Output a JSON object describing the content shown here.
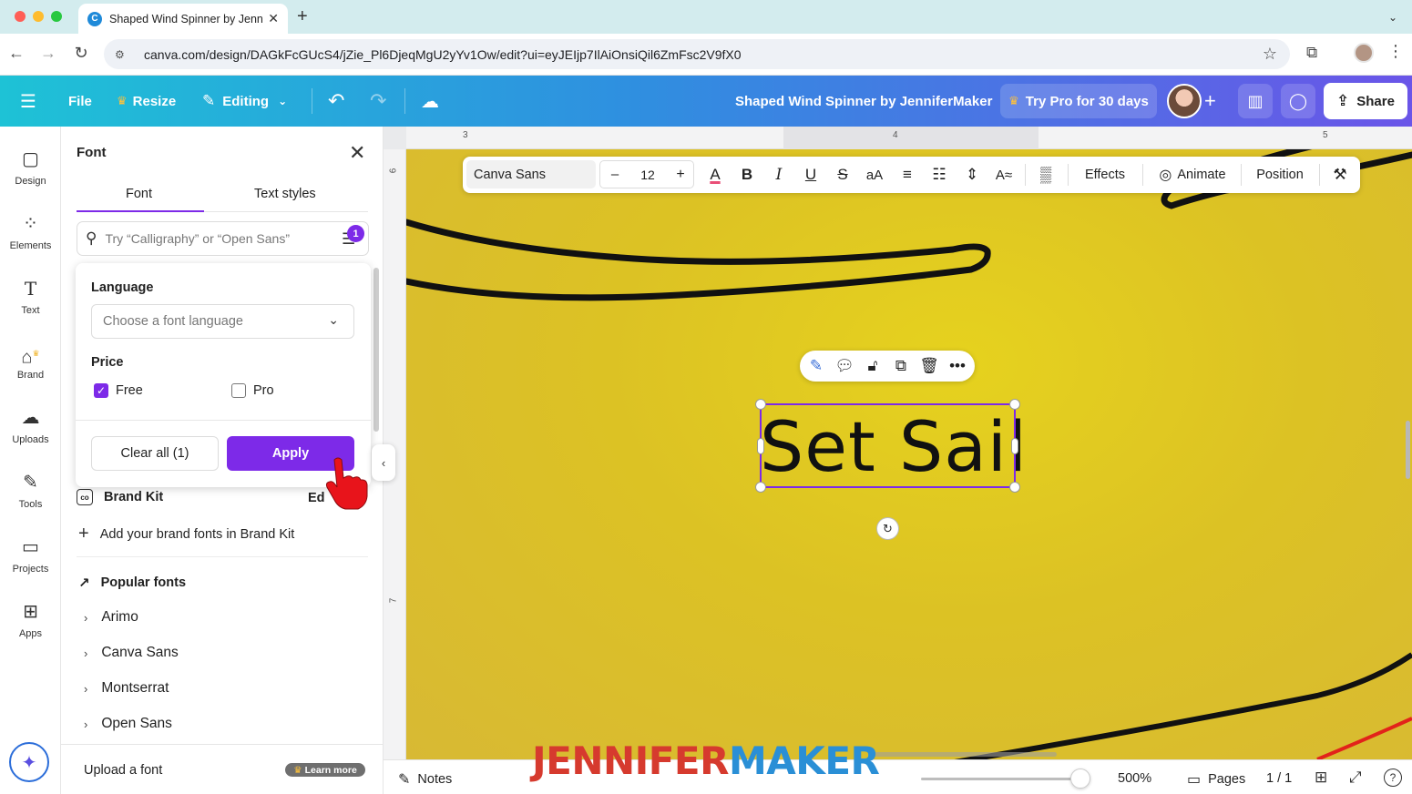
{
  "browser": {
    "tab_title": "Shaped Wind Spinner by Jenni",
    "url": "canva.com/design/DAGkFcGUcS4/jZie_Pl6DjeqMgU2yYv1Ow/edit?ui=eyJEIjp7IlAiOnsiQil6ZmFsc2V9fX0"
  },
  "header": {
    "file": "File",
    "resize": "Resize",
    "editing": "Editing",
    "design_title": "Shaped Wind Spinner by JenniferMaker",
    "try_pro": "Try Pro for 30 days",
    "share": "Share"
  },
  "rail": {
    "items": [
      {
        "label": "Design",
        "icon": "design-icon"
      },
      {
        "label": "Elements",
        "icon": "elements-icon"
      },
      {
        "label": "Text",
        "icon": "text-icon"
      },
      {
        "label": "Brand",
        "icon": "brand-icon"
      },
      {
        "label": "Uploads",
        "icon": "uploads-icon"
      },
      {
        "label": "Tools",
        "icon": "tools-icon"
      },
      {
        "label": "Projects",
        "icon": "projects-icon"
      },
      {
        "label": "Apps",
        "icon": "apps-icon"
      }
    ]
  },
  "font_panel": {
    "title": "Font",
    "tabs": [
      "Font",
      "Text styles"
    ],
    "active_tab": "Font",
    "search_placeholder": "Try “Calligraphy” or “Open Sans”",
    "filter_count": "1",
    "filter": {
      "language_label": "Language",
      "language_placeholder": "Choose a font language",
      "price_label": "Price",
      "free_label": "Free",
      "free_checked": true,
      "pro_label": "Pro",
      "pro_checked": false,
      "clear_label": "Clear all (1)",
      "apply_label": "Apply"
    },
    "brand_kit": "Brand Kit",
    "brand_kit_edit": "Ed",
    "add_brand_fonts": "Add your brand fonts in Brand Kit",
    "popular_title": "Popular fonts",
    "popular_fonts": [
      "Arimo",
      "Canva Sans",
      "Montserrat",
      "Open Sans"
    ],
    "upload_font": "Upload a font",
    "learn_more": "Learn more"
  },
  "ruler": {
    "top_ticks": [
      "3",
      "4",
      "5"
    ],
    "left_ticks": [
      "6",
      "7"
    ]
  },
  "text_toolbar": {
    "font_name": "Canva Sans",
    "font_size": "12",
    "effects": "Effects",
    "animate": "Animate",
    "position": "Position"
  },
  "canvas": {
    "selected_text": "Set Sail",
    "background_color": "#dcc224",
    "selection_color": "#7d2ae8"
  },
  "bottom_bar": {
    "notes": "Notes",
    "zoom": "500%",
    "zoom_fraction": 0.94,
    "pages": "Pages",
    "page_count": "1 / 1"
  },
  "watermark": {
    "part1": "JENNIFER",
    "part2": "MAKER"
  }
}
